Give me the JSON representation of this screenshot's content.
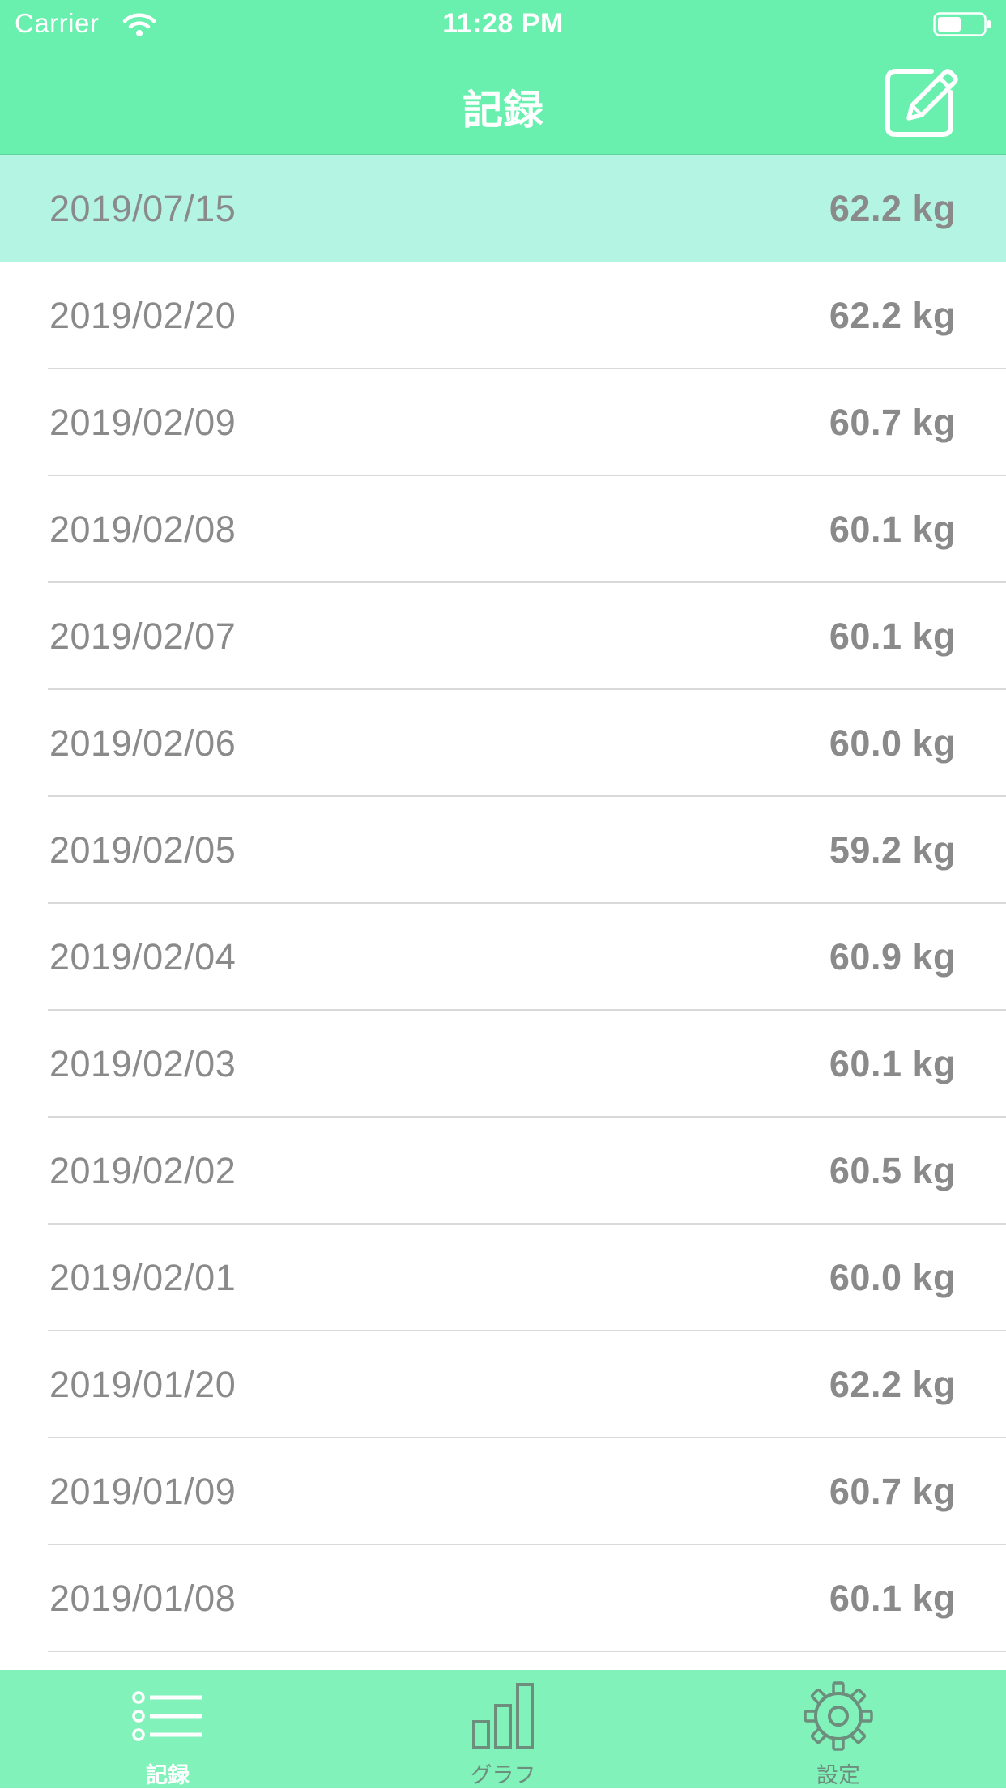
{
  "status_bar": {
    "carrier": "Carrier",
    "time": "11:28 PM"
  },
  "nav": {
    "title": "記録",
    "compose_icon": "compose-icon"
  },
  "records": [
    {
      "date": "2019/07/15",
      "weight": "62.2 kg",
      "selected": true
    },
    {
      "date": "2019/02/20",
      "weight": "62.2 kg"
    },
    {
      "date": "2019/02/09",
      "weight": "60.7 kg"
    },
    {
      "date": "2019/02/08",
      "weight": "60.1 kg"
    },
    {
      "date": "2019/02/07",
      "weight": "60.1 kg"
    },
    {
      "date": "2019/02/06",
      "weight": "60.0 kg"
    },
    {
      "date": "2019/02/05",
      "weight": "59.2 kg"
    },
    {
      "date": "2019/02/04",
      "weight": "60.9 kg"
    },
    {
      "date": "2019/02/03",
      "weight": "60.1 kg"
    },
    {
      "date": "2019/02/02",
      "weight": "60.5 kg"
    },
    {
      "date": "2019/02/01",
      "weight": "60.0 kg"
    },
    {
      "date": "2019/01/20",
      "weight": "62.2 kg"
    },
    {
      "date": "2019/01/09",
      "weight": "60.7 kg"
    },
    {
      "date": "2019/01/08",
      "weight": "60.1 kg"
    }
  ],
  "tabs": [
    {
      "label": "記録",
      "icon": "list-icon",
      "active": true
    },
    {
      "label": "グラフ",
      "icon": "bar-chart-icon",
      "active": false
    },
    {
      "label": "設定",
      "icon": "gear-icon",
      "active": false
    }
  ],
  "colors": {
    "header": "#69f0ae",
    "selected_row": "#b3f5e2",
    "tab_bar": "#82f2bb",
    "text": "#8a8a8a"
  }
}
